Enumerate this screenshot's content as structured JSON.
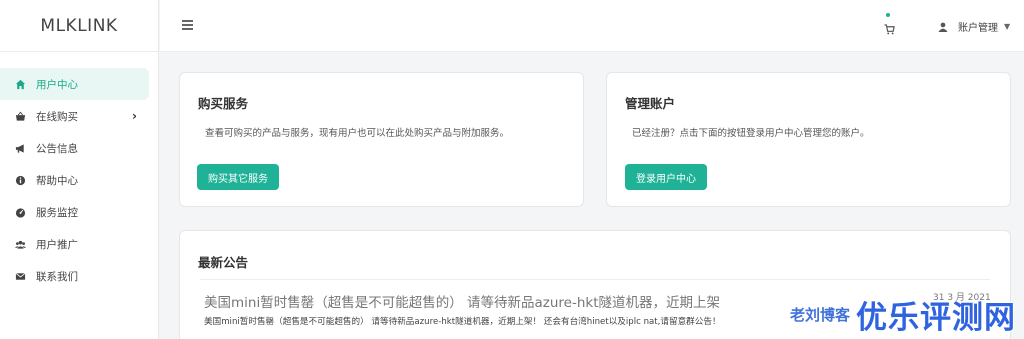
{
  "brand": "MLKLINK",
  "sidebar": {
    "items": [
      {
        "label": "用户中心",
        "icon": "home-icon",
        "active": true
      },
      {
        "label": "在线购买",
        "icon": "basket-icon"
      },
      {
        "label": "公告信息",
        "icon": "megaphone-icon"
      },
      {
        "label": "帮助中心",
        "icon": "info-circle-icon"
      },
      {
        "label": "服务监控",
        "icon": "dashboard-icon"
      },
      {
        "label": "用户推广",
        "icon": "users-icon"
      },
      {
        "label": "联系我们",
        "icon": "envelope-icon"
      }
    ]
  },
  "topbar": {
    "account_label": "账户管理"
  },
  "buy_card": {
    "title": "购买服务",
    "desc": "查看可购买的产品与服务，现有用户也可以在此处购买产品与附加服务。",
    "button": "购买其它服务"
  },
  "account_card": {
    "title": "管理账户",
    "desc": "已经注册？点击下面的按钮登录用户中心管理您的账户。",
    "button": "登录用户中心"
  },
  "notice_card": {
    "title": "最新公告",
    "item_title": "美国mini暂时售罄（超售是不可能超售的） 请等待新品azure-hkt隧道机器，近期上架",
    "item_date": "31 3 月 2021",
    "item_text": "美国mini暂时售罄（超售是不可能超售的） 请等待新品azure-hkt隧道机器，近期上架！ 还会有台湾hinet以及iplc nat,请留意群公告！"
  },
  "watermark": {
    "small": "老刘博客",
    "big": "优乐评测网"
  },
  "colors": {
    "accent": "#1fb297",
    "active_bg": "#e8f7f4",
    "watermark": "#2f63e0"
  }
}
